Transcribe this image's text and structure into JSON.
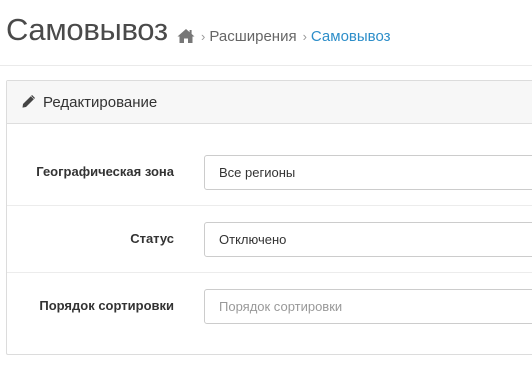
{
  "header": {
    "title": "Самовывоз"
  },
  "breadcrumb": {
    "home_icon": "home-icon",
    "separator": "›",
    "items": [
      {
        "label": "Расширения"
      },
      {
        "label": "Самовывоз"
      }
    ]
  },
  "panel": {
    "icon": "pencil-icon",
    "title": "Редактирование"
  },
  "form": {
    "geo_zone": {
      "label": "Географическая зона",
      "value": "Все регионы"
    },
    "status": {
      "label": "Статус",
      "value": "Отключено"
    },
    "sort_order": {
      "label": "Порядок сортировки",
      "value": "",
      "placeholder": "Порядок сортировки"
    }
  },
  "colors": {
    "link_active": "#2d8ec9",
    "title_text": "#4a4a4a",
    "panel_heading_bg": "#f7f7f7"
  }
}
